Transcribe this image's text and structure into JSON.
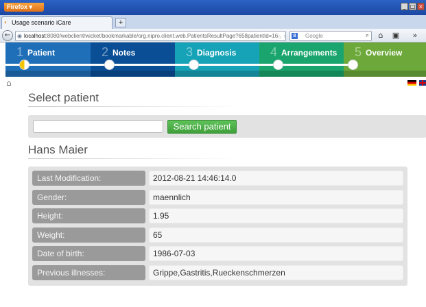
{
  "browser": {
    "menu_button": "Firefox",
    "window_buttons": [
      "_",
      "□",
      "×"
    ],
    "tab_title": "Usage scenario iCare",
    "new_tab": "+",
    "back": "←",
    "url_host": "localhost",
    "url_rest": ":8080/webclient/wicket/bookmarkable/org.nipro.client.web.PatientsResultPage?658patientId=16",
    "url_tools": "☆ ▽ C",
    "search_placeholder": "Google",
    "search_engine_letter": "8",
    "search_go": "⌕",
    "home": "⌂",
    "bookmarks": "▣",
    "menu_extra": "»"
  },
  "wizard": {
    "steps": [
      {
        "number": "1",
        "label": "Patient",
        "color": "#1f6fb8",
        "state": "active"
      },
      {
        "number": "2",
        "label": "Notes",
        "color": "#0a4f96"
      },
      {
        "number": "3",
        "label": "Diagnosis",
        "color": "#17a3b7"
      },
      {
        "number": "4",
        "label": "Arrangements",
        "color": "#19a56d"
      },
      {
        "number": "5",
        "label": "Overview",
        "color": "#6ca93a"
      }
    ]
  },
  "page": {
    "home_icon": "⌂",
    "select_title": "Select patient",
    "search_value": "",
    "search_button": "Search patient",
    "patient_name": "Hans Maier"
  },
  "details": [
    {
      "label": "Last Modification:",
      "value": "2012-08-21 14:46:14.0"
    },
    {
      "label": "Gender:",
      "value": "maennlich"
    },
    {
      "label": "Height:",
      "value": "1.95"
    },
    {
      "label": "Weight:",
      "value": "65"
    },
    {
      "label": "Date of birth:",
      "value": "1986-07-03"
    },
    {
      "label": "Previous illnesses:",
      "value": "Grippe,Gastritis,Rueckenschmerzen"
    }
  ]
}
